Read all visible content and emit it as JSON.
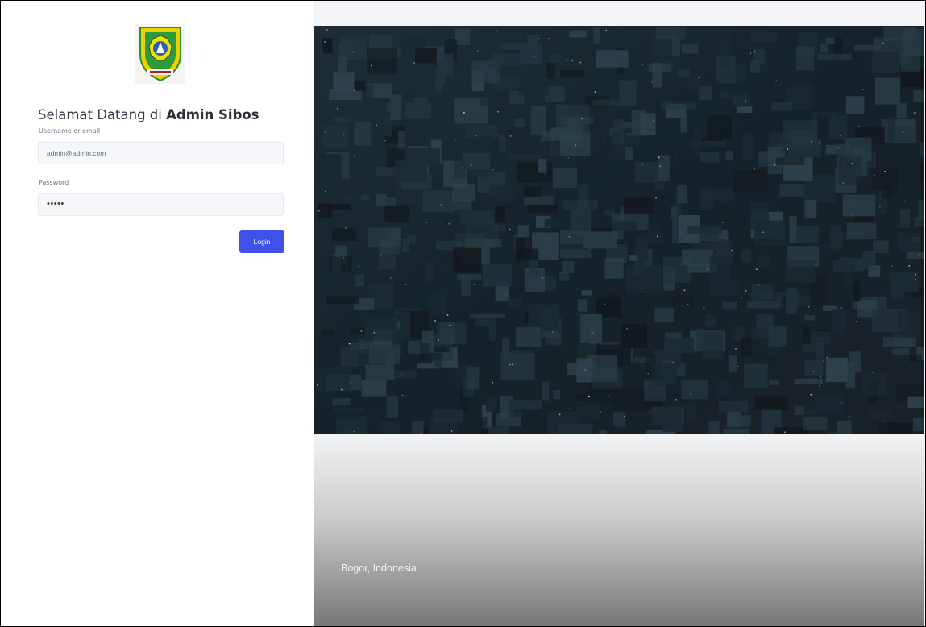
{
  "login": {
    "welcome_prefix": "Selamat Datang di ",
    "welcome_app_name": "Admin Sibos",
    "username_label": "Username or email",
    "username_value": "admin@admin.com",
    "password_label": "Password",
    "password_value": "•••••",
    "login_button": "Login"
  },
  "hero": {
    "location_caption": "Bogor, Indonesia"
  },
  "colors": {
    "accent": "#3f51e8",
    "city_dark": "#16252d"
  },
  "icons": {
    "logo": "kabupaten-bogor-emblem"
  }
}
